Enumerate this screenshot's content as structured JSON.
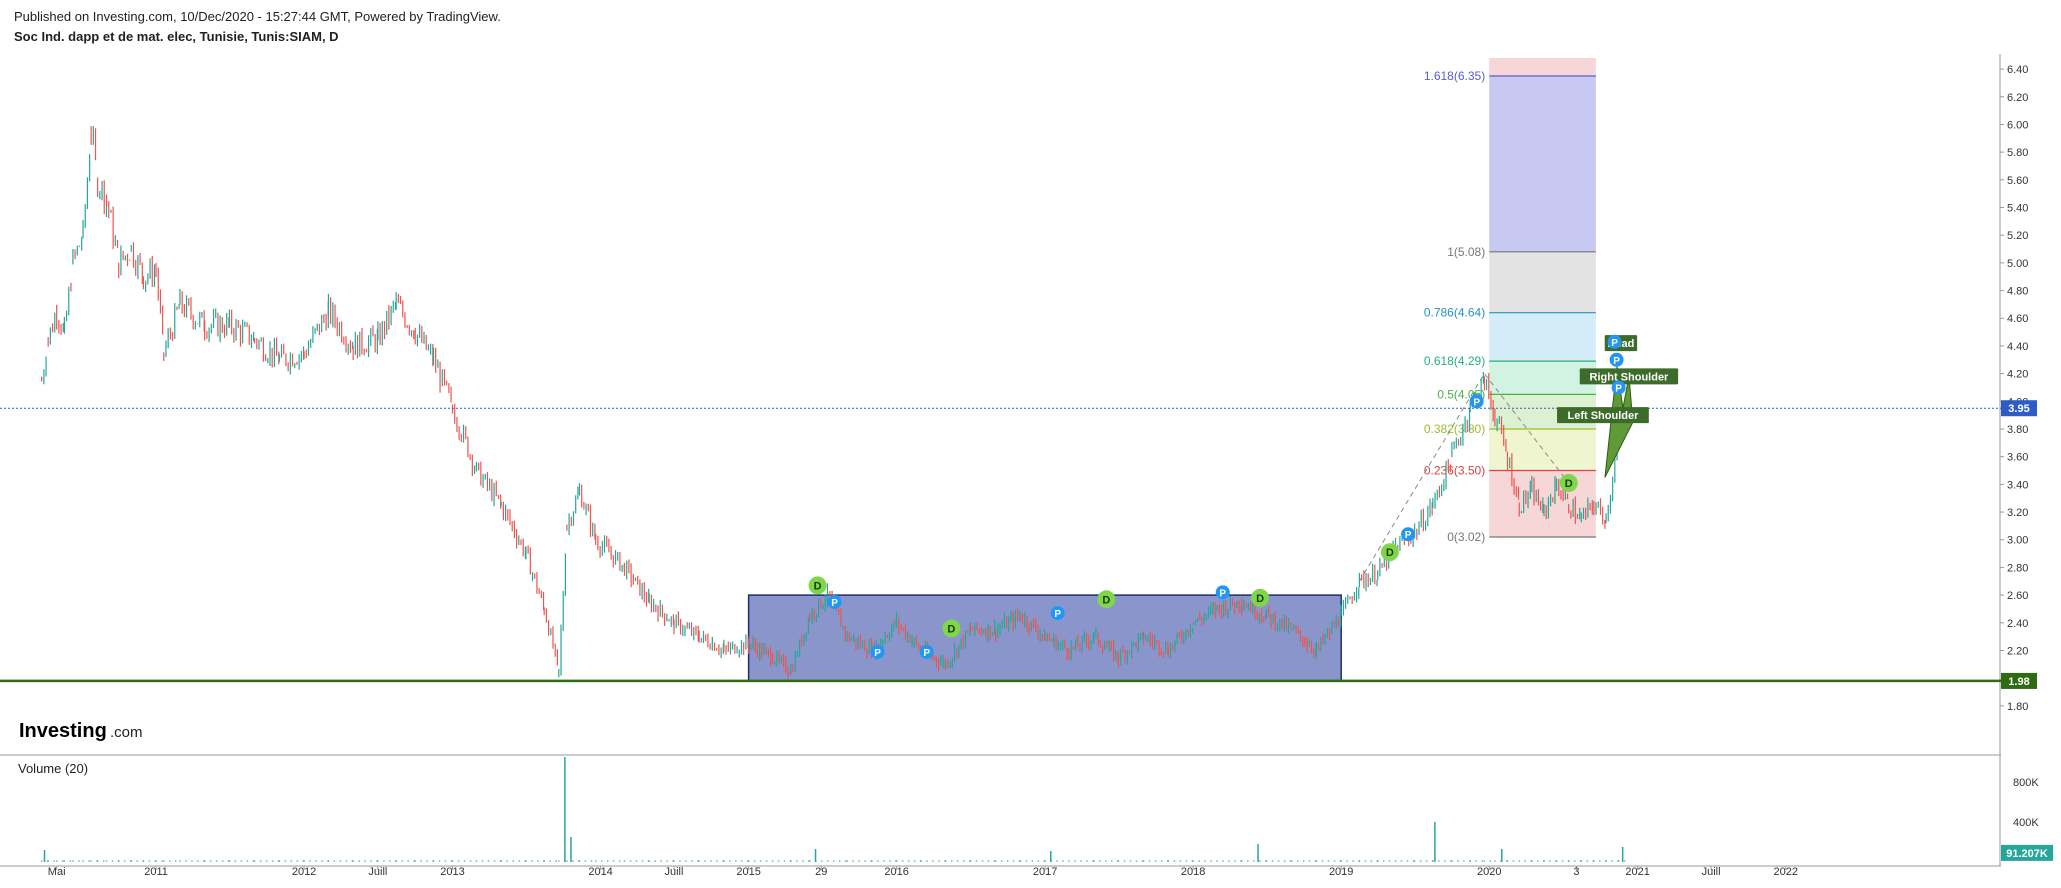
{
  "header": {
    "published": "Published on Investing.com, 10/Dec/2020 - 15:27:44 GMT, Powered by TradingView.",
    "symbol": "Soc Ind. dapp et de mat. elec, Tunisie, Tunis:SIAM, D"
  },
  "branding": {
    "logo_main": "Investing",
    "logo_suffix": ".com"
  },
  "chart_data": {
    "type": "candlestick",
    "price_axis": {
      "range": [
        1.64,
        6.48
      ],
      "ticks": [
        "6.40",
        "6.20",
        "6.00",
        "5.80",
        "5.60",
        "5.40",
        "5.20",
        "5.00",
        "4.80",
        "4.60",
        "4.40",
        "4.20",
        "4.00",
        "3.80",
        "3.60",
        "3.40",
        "3.20",
        "3.00",
        "2.80",
        "2.60",
        "2.40",
        "2.20",
        "1.80"
      ]
    },
    "time_axis": {
      "range": [
        "2010-01-01",
        "2023-06-01"
      ],
      "ticks": [
        {
          "label": "Mai",
          "date": "2010-05-01"
        },
        {
          "label": "2011",
          "date": "2011-01-01"
        },
        {
          "label": "2012",
          "date": "2012-01-01"
        },
        {
          "label": "Juill",
          "date": "2012-07-01"
        },
        {
          "label": "2013",
          "date": "2013-01-01"
        },
        {
          "label": "2014",
          "date": "2014-01-01"
        },
        {
          "label": "Juill",
          "date": "2014-07-01"
        },
        {
          "label": "2015",
          "date": "2015-01-01"
        },
        {
          "label": "29",
          "date": "2015-06-29"
        },
        {
          "label": "2016",
          "date": "2016-01-01"
        },
        {
          "label": "2017",
          "date": "2017-01-01"
        },
        {
          "label": "2018",
          "date": "2018-01-01"
        },
        {
          "label": "2019",
          "date": "2019-01-01"
        },
        {
          "label": "2020",
          "date": "2020-01-01"
        },
        {
          "label": "3",
          "date": "2020-08-03"
        },
        {
          "label": "2021",
          "date": "2021-01-01"
        },
        {
          "label": "Juill",
          "date": "2021-07-01"
        },
        {
          "label": "2022",
          "date": "2022-01-01"
        }
      ]
    },
    "price_series": [
      {
        "date": "2010-03-25",
        "close": 4.15
      },
      {
        "date": "2010-04-10",
        "close": 4.45
      },
      {
        "date": "2010-05-01",
        "close": 4.65
      },
      {
        "date": "2010-05-20",
        "close": 4.5
      },
      {
        "date": "2010-06-10",
        "close": 5.0
      },
      {
        "date": "2010-07-05",
        "close": 5.2
      },
      {
        "date": "2010-07-25",
        "close": 5.95
      },
      {
        "date": "2010-08-10",
        "close": 5.6
      },
      {
        "date": "2010-09-01",
        "close": 5.45
      },
      {
        "date": "2010-10-01",
        "close": 5.0
      },
      {
        "date": "2010-11-01",
        "close": 5.1
      },
      {
        "date": "2010-12-01",
        "close": 4.9
      },
      {
        "date": "2011-01-01",
        "close": 4.95
      },
      {
        "date": "2011-01-20",
        "close": 4.35
      },
      {
        "date": "2011-03-01",
        "close": 4.7
      },
      {
        "date": "2011-05-01",
        "close": 4.55
      },
      {
        "date": "2011-07-01",
        "close": 4.55
      },
      {
        "date": "2011-09-01",
        "close": 4.45
      },
      {
        "date": "2011-11-01",
        "close": 4.3
      },
      {
        "date": "2012-01-01",
        "close": 4.35
      },
      {
        "date": "2012-03-01",
        "close": 4.65
      },
      {
        "date": "2012-05-01",
        "close": 4.4
      },
      {
        "date": "2012-07-01",
        "close": 4.45
      },
      {
        "date": "2012-08-15",
        "close": 4.7
      },
      {
        "date": "2012-10-01",
        "close": 4.5
      },
      {
        "date": "2012-11-15",
        "close": 4.3
      },
      {
        "date": "2013-01-01",
        "close": 3.95
      },
      {
        "date": "2013-03-01",
        "close": 3.5
      },
      {
        "date": "2013-05-01",
        "close": 3.25
      },
      {
        "date": "2013-07-01",
        "close": 2.9
      },
      {
        "date": "2013-08-15",
        "close": 2.5
      },
      {
        "date": "2013-09-20",
        "close": 2.05
      },
      {
        "date": "2013-10-10",
        "close": 3.1
      },
      {
        "date": "2013-11-10",
        "close": 3.35
      },
      {
        "date": "2013-12-20",
        "close": 3.0
      },
      {
        "date": "2014-03-01",
        "close": 2.8
      },
      {
        "date": "2014-05-01",
        "close": 2.55
      },
      {
        "date": "2014-07-01",
        "close": 2.4
      },
      {
        "date": "2014-09-01",
        "close": 2.3
      },
      {
        "date": "2014-11-01",
        "close": 2.2
      },
      {
        "date": "2015-01-01",
        "close": 2.25
      },
      {
        "date": "2015-03-01",
        "close": 2.15
      },
      {
        "date": "2015-04-15",
        "close": 2.05
      },
      {
        "date": "2015-06-01",
        "close": 2.45
      },
      {
        "date": "2015-07-15",
        "close": 2.6
      },
      {
        "date": "2015-09-01",
        "close": 2.3
      },
      {
        "date": "2015-11-01",
        "close": 2.2
      },
      {
        "date": "2016-01-01",
        "close": 2.4
      },
      {
        "date": "2016-03-01",
        "close": 2.2
      },
      {
        "date": "2016-05-01",
        "close": 2.1
      },
      {
        "date": "2016-07-01",
        "close": 2.35
      },
      {
        "date": "2016-09-01",
        "close": 2.35
      },
      {
        "date": "2016-11-01",
        "close": 2.45
      },
      {
        "date": "2017-01-01",
        "close": 2.3
      },
      {
        "date": "2017-03-01",
        "close": 2.2
      },
      {
        "date": "2017-05-01",
        "close": 2.3
      },
      {
        "date": "2017-07-01",
        "close": 2.15
      },
      {
        "date": "2017-09-01",
        "close": 2.3
      },
      {
        "date": "2017-11-01",
        "close": 2.2
      },
      {
        "date": "2018-01-01",
        "close": 2.4
      },
      {
        "date": "2018-03-01",
        "close": 2.5
      },
      {
        "date": "2018-05-01",
        "close": 2.55
      },
      {
        "date": "2018-07-01",
        "close": 2.45
      },
      {
        "date": "2018-09-01",
        "close": 2.35
      },
      {
        "date": "2018-11-01",
        "close": 2.2
      },
      {
        "date": "2019-01-01",
        "close": 2.45
      },
      {
        "date": "2019-02-15",
        "close": 2.7
      },
      {
        "date": "2019-04-01",
        "close": 2.75
      },
      {
        "date": "2019-05-15",
        "close": 2.95
      },
      {
        "date": "2019-07-01",
        "close": 3.05
      },
      {
        "date": "2019-08-15",
        "close": 3.25
      },
      {
        "date": "2019-10-01",
        "close": 3.6
      },
      {
        "date": "2019-11-15",
        "close": 3.95
      },
      {
        "date": "2019-12-20",
        "close": 4.15
      },
      {
        "date": "2020-01-15",
        "close": 3.9
      },
      {
        "date": "2020-02-15",
        "close": 3.6
      },
      {
        "date": "2020-03-15",
        "close": 3.25
      },
      {
        "date": "2020-04-15",
        "close": 3.35
      },
      {
        "date": "2020-05-15",
        "close": 3.2
      },
      {
        "date": "2020-06-15",
        "close": 3.4
      },
      {
        "date": "2020-07-15",
        "close": 3.25
      },
      {
        "date": "2020-08-15",
        "close": 3.15
      },
      {
        "date": "2020-09-15",
        "close": 3.25
      },
      {
        "date": "2020-10-15",
        "close": 3.15
      },
      {
        "date": "2020-11-15",
        "close": 3.75
      },
      {
        "date": "2020-12-10",
        "close": 3.95
      }
    ],
    "current_price": {
      "value": 3.95,
      "label": "3.95"
    },
    "support_line": {
      "value": 1.98,
      "label": "1.98"
    },
    "range_box": {
      "start": "2015-01-01",
      "end": "2019-01-01",
      "top": 2.6,
      "bottom": 1.98
    },
    "fib_retracement": {
      "start_date": "2020-01-01",
      "end_date": "2020-09-20",
      "levels": [
        {
          "label": "1.618(6.35)",
          "value": 6.35,
          "color": "#5b5bd6"
        },
        {
          "label": "1(5.08)",
          "value": 5.08,
          "color": "#777777"
        },
        {
          "label": "0.786(4.64)",
          "value": 4.64,
          "color": "#2a8fc9"
        },
        {
          "label": "0.618(4.29)",
          "value": 4.29,
          "color": "#22b07d"
        },
        {
          "label": "0.5(4.05)",
          "value": 4.05,
          "color": "#4caf50"
        },
        {
          "label": "0.382(3.80)",
          "value": 3.8,
          "color": "#9bbf2c"
        },
        {
          "label": "0.236(3.50)",
          "value": 3.5,
          "color": "#d64545"
        },
        {
          "label": "0(3.02)",
          "value": 3.02,
          "color": "#777777"
        }
      ]
    },
    "head_shoulders_labels": [
      "Head",
      "Right Shoulder",
      "Left Shoulder"
    ],
    "markers_d": [
      {
        "date": "2015-06-20",
        "price": 2.67
      },
      {
        "date": "2016-05-15",
        "price": 2.36
      },
      {
        "date": "2017-06-01",
        "price": 2.57
      },
      {
        "date": "2018-06-15",
        "price": 2.58
      },
      {
        "date": "2019-05-01",
        "price": 2.91
      },
      {
        "date": "2020-07-15",
        "price": 3.41
      }
    ],
    "markers_p": [
      {
        "date": "2015-08-01",
        "price": 2.55
      },
      {
        "date": "2015-11-15",
        "price": 2.19
      },
      {
        "date": "2016-03-15",
        "price": 2.19
      },
      {
        "date": "2017-02-01",
        "price": 2.47
      },
      {
        "date": "2018-03-15",
        "price": 2.62
      },
      {
        "date": "2019-06-15",
        "price": 3.04
      },
      {
        "date": "2019-12-01",
        "price": 4.0
      },
      {
        "date": "2020-11-05",
        "price": 4.43
      },
      {
        "date": "2020-11-10",
        "price": 4.3
      },
      {
        "date": "2020-11-15",
        "price": 4.1
      }
    ],
    "volume_panel": {
      "title": "Volume (20)",
      "axis_ticks": [
        "800K",
        "400K"
      ],
      "range": [
        0,
        1100
      ],
      "current": {
        "value": 91.207,
        "label": "91.207K"
      },
      "spikes": [
        {
          "date": "2010-04-01",
          "value": 120
        },
        {
          "date": "2013-10-05",
          "value": 1050
        },
        {
          "date": "2013-10-20",
          "value": 250
        },
        {
          "date": "2015-06-15",
          "value": 130
        },
        {
          "date": "2017-01-15",
          "value": 110
        },
        {
          "date": "2018-06-10",
          "value": 180
        },
        {
          "date": "2019-08-20",
          "value": 400
        },
        {
          "date": "2020-02-01",
          "value": 130
        },
        {
          "date": "2020-11-25",
          "value": 150
        }
      ]
    },
    "colors": {
      "up": "#26a69a",
      "down": "#ef5350",
      "support": "#2e6b12",
      "range_box_fill": "#7584c2",
      "range_box_stroke": "#1f2e73",
      "current_price_tag": "#2e5cc7",
      "volume_tag": "#26a69a",
      "marker_d": "#7fd64c",
      "marker_p": "#2196f3",
      "pattern_fill": "#5f9a37"
    }
  }
}
